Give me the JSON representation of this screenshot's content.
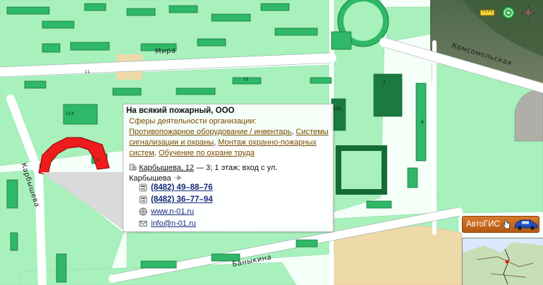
{
  "streets": {
    "mira": "Мира",
    "komsomolskaya": "Комсомольская",
    "karbysheva": "Карбышева",
    "banykina": "Баныкина"
  },
  "building_numbers": [
    "11",
    "113",
    "11",
    "5",
    "133",
    "5",
    "6",
    "7"
  ],
  "popup": {
    "title": "На всякий пожарный, ООО",
    "section_label": "Сферы деятельности организации:",
    "categories": [
      "Противопожарное оборудование / инвентарь",
      "Системы сигнализации и охраны",
      "Монтаж охранно-пожарных систем",
      "Обучение по охране труда"
    ],
    "address_link": "Карбышева, 12",
    "address_rest": "— 3; 1 этаж; вход с ул.",
    "address_line2": "Карбышева",
    "phone1": "(8482) 49–88–76",
    "phone2": "(8482) 36–77–94",
    "website": "www.n-01.ru",
    "email": "info@n-01.ru"
  },
  "toolbar": {
    "icons": [
      "ruler-icon",
      "radar-icon",
      "compass-icon"
    ]
  },
  "autogis": {
    "label": "АвтоГИС"
  },
  "colors": {
    "background": "#f4fff8",
    "block": "#a8f0bc",
    "building": "#2eb867",
    "building_dark": "#1a7a3f",
    "highlight": "#ee1c1c",
    "sand": "#eed9a8",
    "street_label": "#222222",
    "link": "#7a4a00",
    "contact": "#13287a"
  }
}
